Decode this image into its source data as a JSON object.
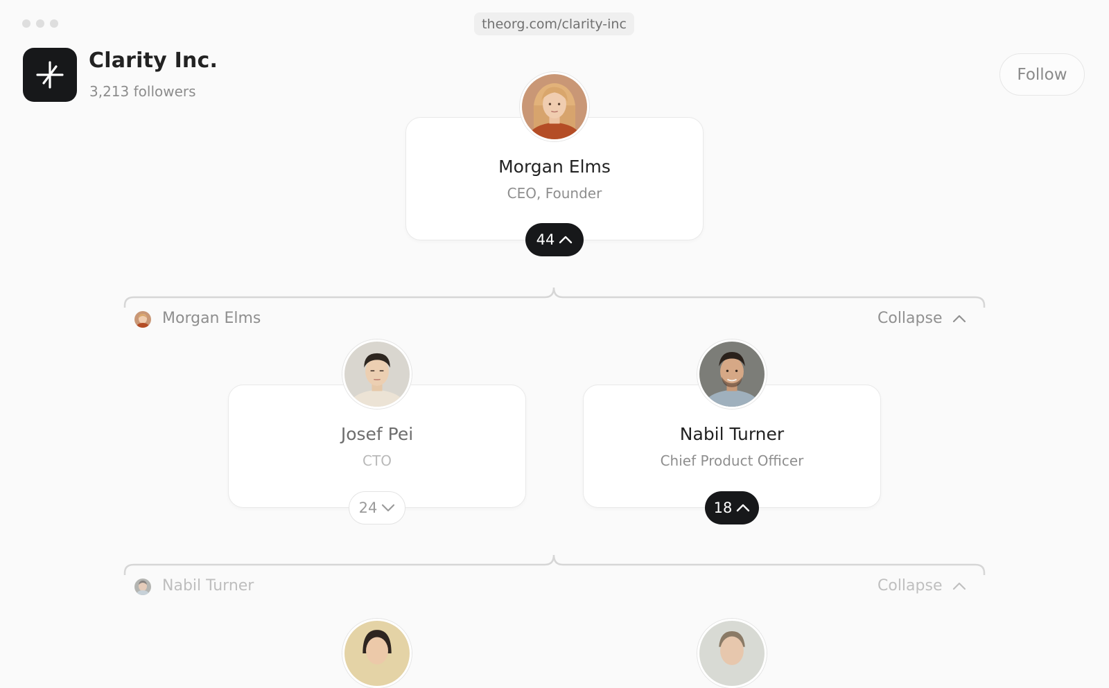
{
  "browser": {
    "url": "theorg.com/clarity-inc"
  },
  "company": {
    "name": "Clarity Inc.",
    "followers": "3,213 followers",
    "follow_label": "Follow",
    "logo_icon": "asterisk-icon"
  },
  "ceo": {
    "name": "Morgan Elms",
    "role": "CEO, Founder",
    "reports_count": "44",
    "expanded": true
  },
  "group_morgan": {
    "manager": "Morgan Elms",
    "collapse_label": "Collapse"
  },
  "reports": [
    {
      "name": "Josef Pei",
      "role": "CTO",
      "reports_count": "24",
      "expanded": false
    },
    {
      "name": "Nabil Turner",
      "role": "Chief Product Officer",
      "reports_count": "18",
      "expanded": true
    }
  ],
  "group_nabil": {
    "manager": "Nabil Turner",
    "collapse_label": "Collapse"
  },
  "colors": {
    "background": "#fafafa",
    "dark_pill": "#17181a",
    "card_border": "#e9e9e9",
    "connector": "#d6d6d6"
  }
}
